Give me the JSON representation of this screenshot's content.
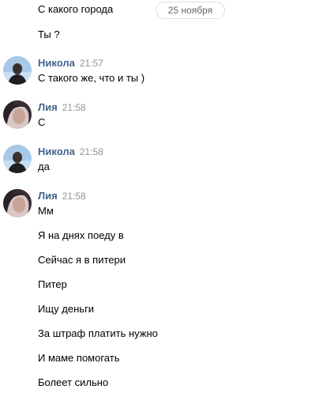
{
  "date_separator": "25 ноября",
  "pre_messages": [
    {
      "text": "С какого города"
    },
    {
      "text": "Ты ?"
    }
  ],
  "groups": [
    {
      "author": "Никола",
      "time": "21:57",
      "messages": [
        "С такого же, что и ты )"
      ]
    },
    {
      "author": "Лия",
      "time": "21:58",
      "messages": [
        "С"
      ]
    },
    {
      "author": "Никола",
      "time": "21:58",
      "messages": [
        "да"
      ]
    },
    {
      "author": "Лия",
      "time": "21:58",
      "messages": [
        "Мм",
        "Я на днях поеду в",
        "Сейчас я в питери",
        "Питер",
        "Ищу деньги",
        "За штраф платить нужно",
        "И маме помогать",
        "Болеет сильно"
      ]
    }
  ],
  "colors": {
    "author_name": "#42648b",
    "timestamp": "#939393",
    "avatar_nikola_bg": "#a8c8e8",
    "avatar_liya_bg": "#d8c8c8"
  },
  "icons": {
    "avatar_nikola": "user-avatar-photo",
    "avatar_liya": "user-avatar-photo"
  }
}
